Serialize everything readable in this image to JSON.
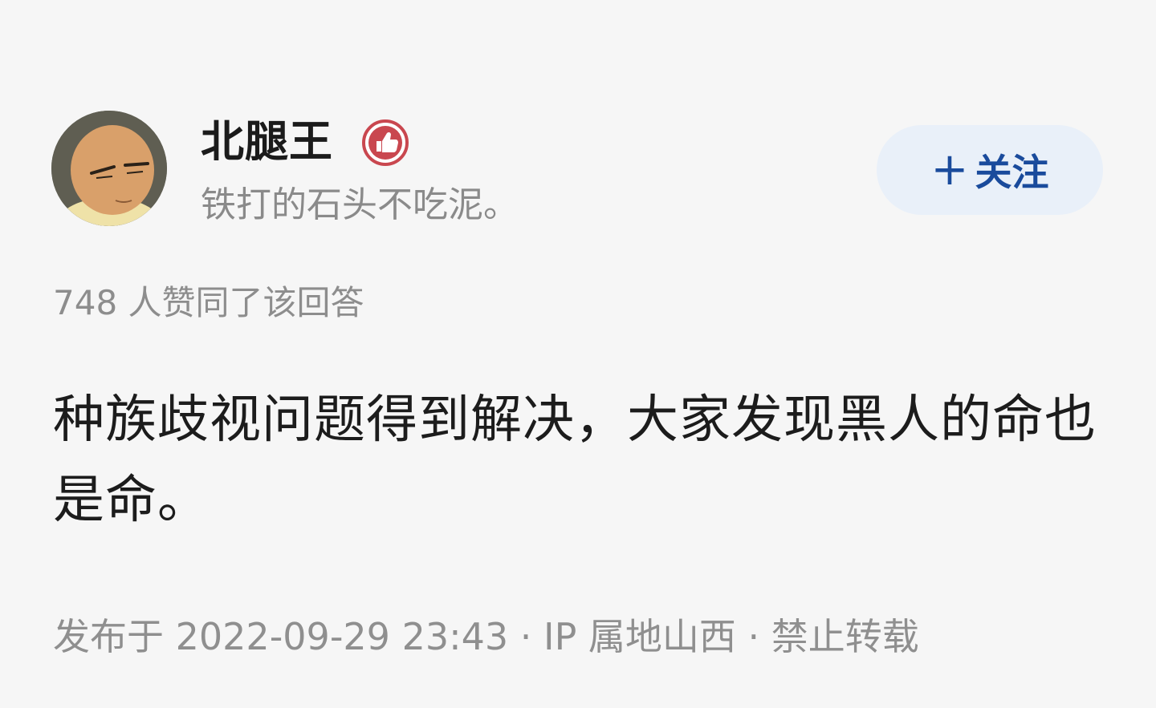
{
  "author": {
    "name": "北腿王",
    "bio": "铁打的石头不吃泥。",
    "badge_icon": "thumbs-up-badge-icon",
    "badge_color": "#c9474f"
  },
  "follow_button": {
    "plus": "+",
    "label": "关注"
  },
  "upvote_text": "748 人赞同了该回答",
  "answer_text": "种族歧视问题得到解决，大家发现黑人的命也是命。",
  "meta": {
    "text": "发布于 2022-09-29 23:43 · IP 属地山西 · 禁止转载"
  },
  "colors": {
    "background": "#f6f6f6",
    "follow_bg": "#e9f0f9",
    "follow_text": "#1a4b9c",
    "secondary_text": "#8a8a8a"
  }
}
